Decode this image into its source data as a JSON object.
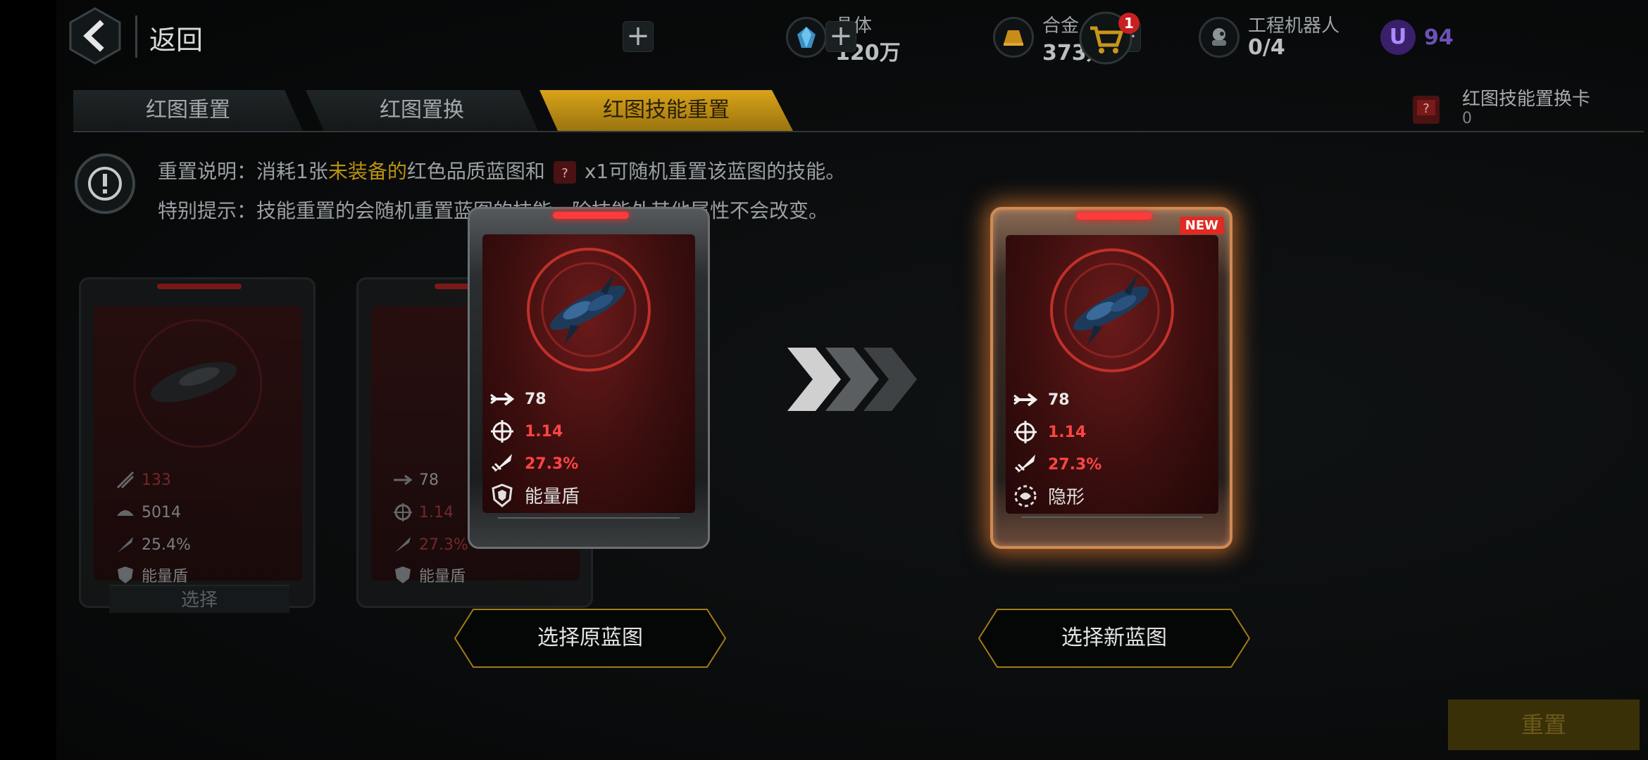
{
  "header": {
    "back_label": "返回",
    "resources": [
      {
        "name": "晶体",
        "value": "120万",
        "icon": "crystal-icon"
      },
      {
        "name": "合金",
        "value": "373万",
        "icon": "alloy-icon"
      },
      {
        "name": "工程机器人",
        "value": "0/4",
        "icon": "robot-icon"
      }
    ],
    "premium": {
      "badge": "U",
      "value": "94"
    },
    "cart_badge": "1"
  },
  "tabs": [
    {
      "label": "红图重置",
      "active": false
    },
    {
      "label": "红图置换",
      "active": false
    },
    {
      "label": "红图技能重置",
      "active": true
    }
  ],
  "card_counter": {
    "name": "红图技能置换卡",
    "value": "0"
  },
  "info": {
    "line1_prefix": "重置说明：消耗1张",
    "line1_highlight": "未装备的",
    "line1_mid": "红色品质蓝图和",
    "line1_suffix": "x1可随机重置该蓝图的技能。",
    "line2": "特别提示：技能重置的会随机重置蓝图的技能，除技能外其他属性不会改变。"
  },
  "blueprint_list": [
    {
      "stats": [
        "133",
        "5014",
        "25.4%"
      ],
      "skill": "能量盾",
      "select_label": "选择"
    },
    {
      "stats": [
        "78",
        "1.14",
        "27.3%"
      ],
      "skill": "能量盾"
    }
  ],
  "original_card": {
    "speed": "78",
    "accuracy": "1.14",
    "crit": "27.3%",
    "skill": "能量盾",
    "button": "选择原蓝图"
  },
  "new_card": {
    "badge": "NEW",
    "speed": "78",
    "accuracy": "1.14",
    "crit": "27.3%",
    "skill": "隐形",
    "button": "选择新蓝图"
  },
  "reset_button": "重置",
  "colors": {
    "accent": "#d9a41a",
    "stat_red": "#ff4444",
    "new_glow": "#d08a52"
  }
}
